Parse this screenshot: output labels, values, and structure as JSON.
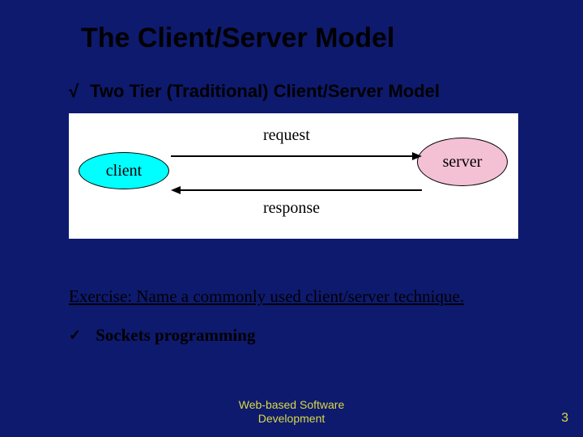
{
  "title": "The Client/Server Model",
  "bullet": {
    "mark": "√",
    "text": "Two Tier (Traditional) Client/Server Model"
  },
  "diagram": {
    "client_label": "client",
    "server_label": "server",
    "top_arrow_label": "request",
    "bottom_arrow_label": "response",
    "client_color": "#00ffff",
    "server_color": "#f4c0d4"
  },
  "exercise_text": "Exercise: Name a commonly used client/server technique.",
  "answer": {
    "mark": "✓",
    "text": "Sockets programming"
  },
  "footer_line1": "Web-based Software",
  "footer_line2": "Development",
  "page_number": "3"
}
